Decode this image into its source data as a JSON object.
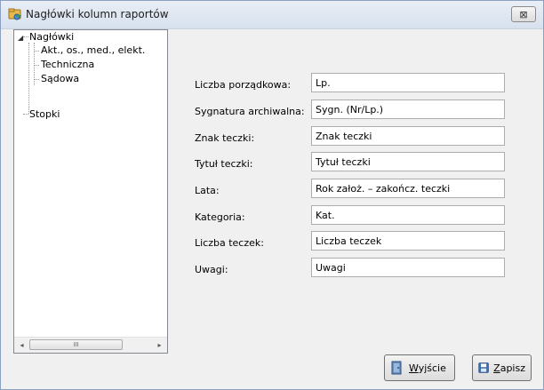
{
  "window": {
    "title": "Nagłówki kolumn raportów",
    "close_glyph": "⊠",
    "icon": "folder-key-icon"
  },
  "tree": {
    "root_label": "Nagłówki",
    "children": [
      "Akt., os., med., elekt.",
      "Techniczna",
      "Sądowa"
    ],
    "second_root_label": "Stopki",
    "scroll_left": "◂",
    "scroll_right": "▸",
    "scroll_grip": "III"
  },
  "form": {
    "fields": [
      {
        "label": "Liczba porządkowa:",
        "value": "Lp."
      },
      {
        "label": "Sygnatura archiwalna:",
        "value": "Sygn. (Nr/Lp.)"
      },
      {
        "label": "Znak teczki:",
        "value": "Znak teczki"
      },
      {
        "label": "Tytuł teczki:",
        "value": "Tytuł teczki"
      },
      {
        "label": "Lata:",
        "value": "Rok założ. – zakończ. teczki"
      },
      {
        "label": "Kategoria:",
        "value": "Kat."
      },
      {
        "label": "Liczba teczek:",
        "value": "Liczba teczek"
      },
      {
        "label": "Uwagi:",
        "value": "Uwagi"
      }
    ]
  },
  "buttons": {
    "exit_underlined": "W",
    "exit_rest": "yjście",
    "save_underlined": "Z",
    "save_rest": "apisz"
  }
}
